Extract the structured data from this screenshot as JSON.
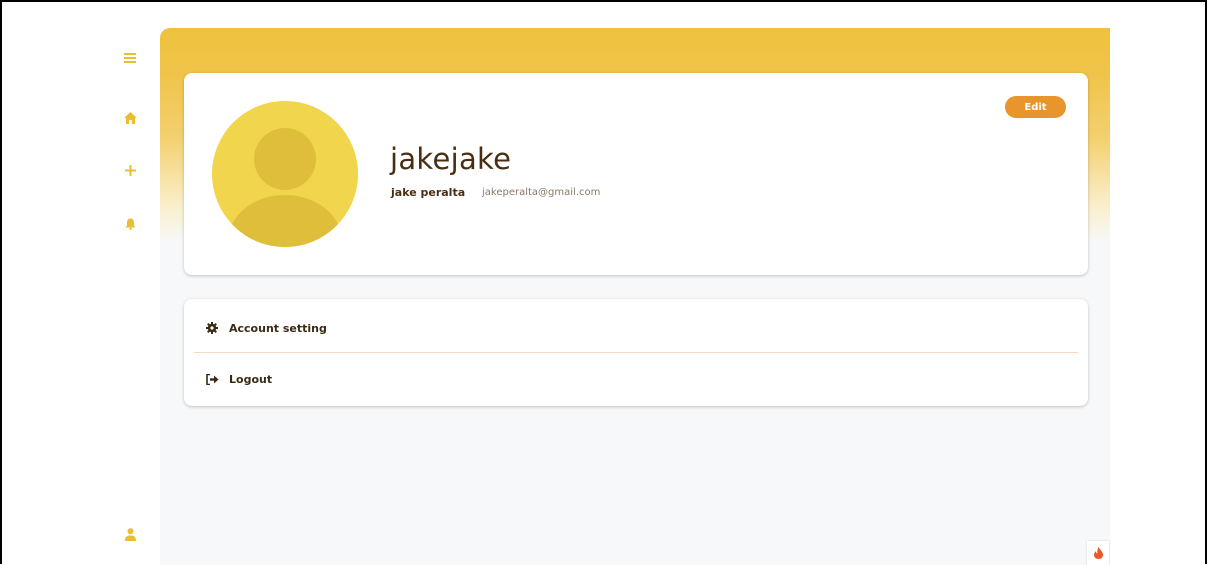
{
  "sidebar": {
    "icons": [
      "menu-icon",
      "home-icon",
      "plus-icon",
      "bell-icon",
      "user-icon"
    ],
    "accent_color": "#e9be34"
  },
  "profile": {
    "username": "jakejake",
    "full_name": "jake peralta",
    "email": "jakeperalta@gmail.com",
    "edit_label": "Edit",
    "avatar_icon": "avatar-placeholder-icon"
  },
  "menu": {
    "items": [
      {
        "label": "Account setting",
        "icon": "gear-icon"
      },
      {
        "label": "Logout",
        "icon": "logout-icon"
      }
    ]
  },
  "colors": {
    "header_gradient_top": "#efc13d",
    "edit_button": "#e8952b",
    "text_dark": "#4a2e12",
    "background": "#f6f8fa"
  },
  "floating_widget": {
    "icon": "flame-icon"
  }
}
